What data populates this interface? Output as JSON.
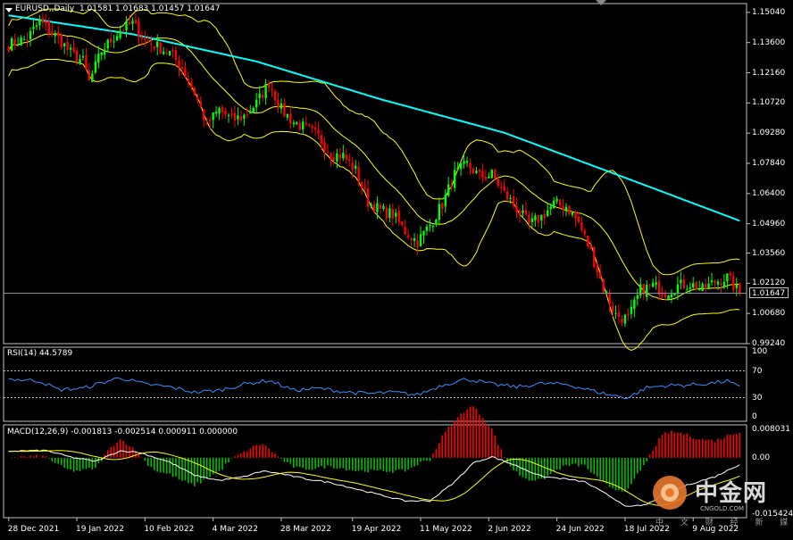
{
  "header": {
    "symbol_line": "EURUSD,,Daily  1.01581 1.01683 1.01457 1.01647"
  },
  "rsi": {
    "title": "RSI(14) 44.5789",
    "axis_ticks": [
      "100",
      "70",
      "30",
      "0"
    ],
    "levels": [
      70,
      30
    ]
  },
  "macd": {
    "title": "MACD(12,26,9) -0.001813 -0.002514 0.000911 0.000000",
    "axis_ticks": [
      "0.008031",
      "0.00",
      "-0.015424"
    ]
  },
  "price_axis": {
    "ticks": [
      "1.15040",
      "1.13600",
      "1.12160",
      "1.10720",
      "1.09280",
      "1.07840",
      "1.06400",
      "1.04960",
      "1.03560",
      "1.02120",
      "1.00680",
      "0.99240"
    ],
    "current_price": "1.01647"
  },
  "date_axis": [
    "28 Dec 2021",
    "19 Jan 2022",
    "10 Feb 2022",
    "4 Mar 2022",
    "28 Mar 2022",
    "19 Apr 2022",
    "11 May 2022",
    "2 Jun 2022",
    "24 Jun 2022",
    "18 Jul 2022",
    "9 Aug 2022"
  ],
  "watermark": {
    "brand_cn": "中金网",
    "brand_en": "CNGOLD.COM",
    "tagline": "中 文 财 经 新 媒 体"
  },
  "colors": {
    "background": "#000000",
    "bull_candle": "#00ff00",
    "bear_candle": "#ff0000",
    "bollinger": "#ffff00",
    "moving_average": "#00ffff",
    "rsi_line": "#3a8fff",
    "macd_line": "#ffffff",
    "signal_line": "#ffff00",
    "osma_positive": "#ff0000",
    "osma_negative": "#00c000"
  },
  "chart_data": {
    "type": "candlestick",
    "title": "EURUSD,,Daily",
    "ylim": [
      0.9924,
      1.1546
    ],
    "anchors": {
      "close_path": [
        [
          0,
          1.135
        ],
        [
          6,
          1.138
        ],
        [
          10,
          1.146
        ],
        [
          16,
          1.138
        ],
        [
          20,
          1.131
        ],
        [
          24,
          1.127
        ],
        [
          26,
          1.117
        ],
        [
          30,
          1.132
        ],
        [
          36,
          1.142
        ],
        [
          40,
          1.145
        ],
        [
          44,
          1.137
        ],
        [
          48,
          1.134
        ],
        [
          52,
          1.131
        ],
        [
          56,
          1.124
        ],
        [
          60,
          1.112
        ],
        [
          64,
          1.097
        ],
        [
          68,
          1.104
        ],
        [
          72,
          1.099
        ],
        [
          76,
          1.101
        ],
        [
          80,
          1.107
        ],
        [
          84,
          1.117
        ],
        [
          88,
          1.104
        ],
        [
          92,
          1.098
        ],
        [
          96,
          1.095
        ],
        [
          100,
          1.091
        ],
        [
          104,
          1.083
        ],
        [
          108,
          1.082
        ],
        [
          112,
          1.075
        ],
        [
          116,
          1.06
        ],
        [
          120,
          1.056
        ],
        [
          124,
          1.054
        ],
        [
          128,
          1.046
        ],
        [
          132,
          1.041
        ],
        [
          136,
          1.049
        ],
        [
          140,
          1.059
        ],
        [
          144,
          1.073
        ],
        [
          148,
          1.078
        ],
        [
          152,
          1.072
        ],
        [
          156,
          1.073
        ],
        [
          160,
          1.064
        ],
        [
          164,
          1.057
        ],
        [
          168,
          1.049
        ],
        [
          172,
          1.053
        ],
        [
          176,
          1.059
        ],
        [
          180,
          1.058
        ],
        [
          184,
          1.05
        ],
        [
          188,
          1.036
        ],
        [
          192,
          1.019
        ],
        [
          196,
          1.006
        ],
        [
          200,
          1.004
        ],
        [
          204,
          1.018
        ],
        [
          208,
          1.02
        ],
        [
          212,
          1.017
        ],
        [
          216,
          1.02
        ],
        [
          220,
          1.021
        ],
        [
          224,
          1.018
        ],
        [
          228,
          1.022
        ],
        [
          232,
          1.024
        ],
        [
          236,
          1.016
        ]
      ],
      "ma_path": [
        [
          0,
          1.149
        ],
        [
          40,
          1.14
        ],
        [
          80,
          1.127
        ],
        [
          120,
          1.109
        ],
        [
          160,
          1.093
        ],
        [
          200,
          1.071
        ],
        [
          236,
          1.051
        ]
      ],
      "bb_width": 0.019,
      "rsi_path": [
        [
          0,
          58
        ],
        [
          10,
          55
        ],
        [
          16,
          42
        ],
        [
          24,
          44
        ],
        [
          30,
          52
        ],
        [
          36,
          60
        ],
        [
          44,
          50
        ],
        [
          52,
          46
        ],
        [
          60,
          38
        ],
        [
          68,
          41
        ],
        [
          76,
          50
        ],
        [
          84,
          56
        ],
        [
          92,
          41
        ],
        [
          100,
          44
        ],
        [
          108,
          39
        ],
        [
          116,
          36
        ],
        [
          124,
          38
        ],
        [
          132,
          34
        ],
        [
          140,
          49
        ],
        [
          148,
          58
        ],
        [
          156,
          50
        ],
        [
          164,
          46
        ],
        [
          172,
          51
        ],
        [
          180,
          50
        ],
        [
          188,
          41
        ],
        [
          194,
          34
        ],
        [
          200,
          30
        ],
        [
          206,
          45
        ],
        [
          212,
          48
        ],
        [
          220,
          49
        ],
        [
          226,
          51
        ],
        [
          232,
          55
        ],
        [
          236,
          45
        ]
      ],
      "macd_path": [
        [
          0,
          0.0018
        ],
        [
          12,
          0.002
        ],
        [
          20,
          0.0002
        ],
        [
          28,
          -0.001
        ],
        [
          36,
          0.0019
        ],
        [
          42,
          0.0015
        ],
        [
          52,
          -0.0012
        ],
        [
          60,
          -0.0048
        ],
        [
          68,
          -0.0062
        ],
        [
          76,
          -0.0052
        ],
        [
          82,
          -0.0036
        ],
        [
          88,
          -0.0044
        ],
        [
          96,
          -0.0058
        ],
        [
          104,
          -0.0068
        ],
        [
          112,
          -0.0085
        ],
        [
          120,
          -0.0102
        ],
        [
          128,
          -0.0118
        ],
        [
          136,
          -0.0118
        ],
        [
          144,
          -0.0066
        ],
        [
          150,
          -0.0014
        ],
        [
          156,
          0.0003
        ],
        [
          164,
          -0.0022
        ],
        [
          172,
          -0.0051
        ],
        [
          180,
          -0.0058
        ],
        [
          186,
          -0.0066
        ],
        [
          194,
          -0.0105
        ],
        [
          200,
          -0.0135
        ],
        [
          206,
          -0.0128
        ],
        [
          212,
          -0.0098
        ],
        [
          220,
          -0.0072
        ],
        [
          228,
          -0.0052
        ],
        [
          236,
          -0.0018
        ]
      ],
      "signal_lag": 4
    },
    "bars": 237,
    "x_labels": [
      "28 Dec 2021",
      "19 Jan 2022",
      "10 Feb 2022",
      "4 Mar 2022",
      "28 Mar 2022",
      "19 Apr 2022",
      "11 May 2022",
      "2 Jun 2022",
      "24 Jun 2022",
      "18 Jul 2022",
      "9 Aug 2022"
    ],
    "last_close": 1.01647,
    "indicators": [
      "Bollinger Bands",
      "Moving Average",
      "RSI(14)",
      "MACD(12,26,9)"
    ]
  }
}
